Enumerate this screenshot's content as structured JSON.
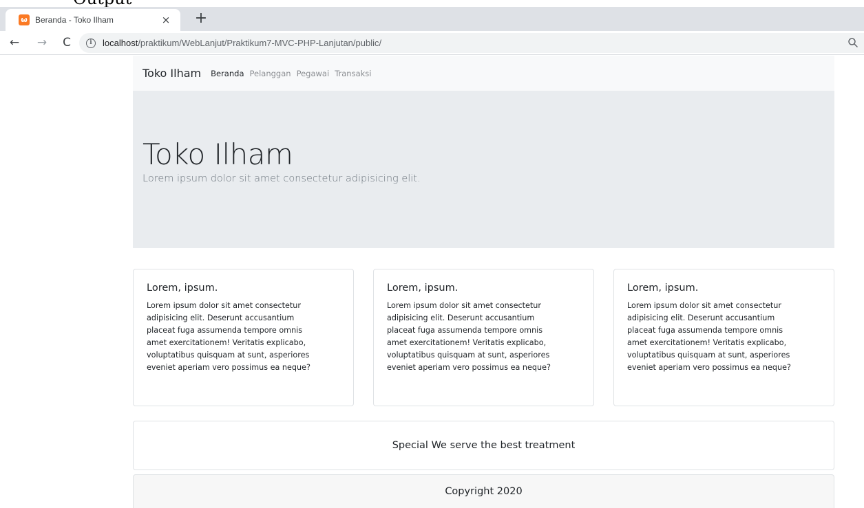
{
  "caption": "Output",
  "browser": {
    "tab": {
      "favicon_glyph": "ω",
      "title": "Beranda - Toko Ilham",
      "close_glyph": "×"
    },
    "new_tab_glyph": "+",
    "nav": {
      "back_glyph": "←",
      "forward_glyph": "→",
      "reload_glyph": "C"
    },
    "info_glyph": "i",
    "url": {
      "host": "localhost",
      "path": "/praktikum/WebLanjut/Praktikum7-MVC-PHP-Lanjutan/public/"
    },
    "accent_color": "#fb7a24"
  },
  "navbar": {
    "brand": "Toko Ilham",
    "links": [
      {
        "label": "Beranda",
        "active": true
      },
      {
        "label": "Pelanggan",
        "active": false
      },
      {
        "label": "Pegawai",
        "active": false
      },
      {
        "label": "Transaksi",
        "active": false
      }
    ]
  },
  "jumbotron": {
    "title": "Toko Ilham",
    "lead": "Lorem ipsum dolor sit amet consectetur adipisicing elit."
  },
  "cards": [
    {
      "title": "Lorem, ipsum.",
      "lines": [
        "Lorem ipsum dolor sit amet consectetur",
        "adipisicing elit. Deserunt accusantium",
        "placeat fuga assumenda tempore omnis",
        "amet exercitationem! Veritatis explicabo,",
        "voluptatibus quisquam at sunt, asperiores",
        "eveniet aperiam vero possimus ea neque?"
      ]
    },
    {
      "title": "Lorem, ipsum.",
      "lines": [
        "Lorem ipsum dolor sit amet consectetur",
        "adipisicing elit. Deserunt accusantium",
        "placeat fuga assumenda tempore omnis",
        "amet exercitationem! Veritatis explicabo,",
        "voluptatibus quisquam at sunt, asperiores",
        "eveniet aperiam vero possimus ea neque?"
      ]
    },
    {
      "title": "Lorem, ipsum.",
      "lines": [
        "Lorem ipsum dolor sit amet consectetur",
        "adipisicing elit. Deserunt accusantium",
        "placeat fuga assumenda tempore omnis",
        "amet exercitationem! Veritatis explicabo,",
        "voluptatibus quisquam at sunt, asperiores",
        "eveniet aperiam vero possimus ea neque?"
      ]
    }
  ],
  "special": "Special We serve the best treatment",
  "footer": "Copyright 2020"
}
